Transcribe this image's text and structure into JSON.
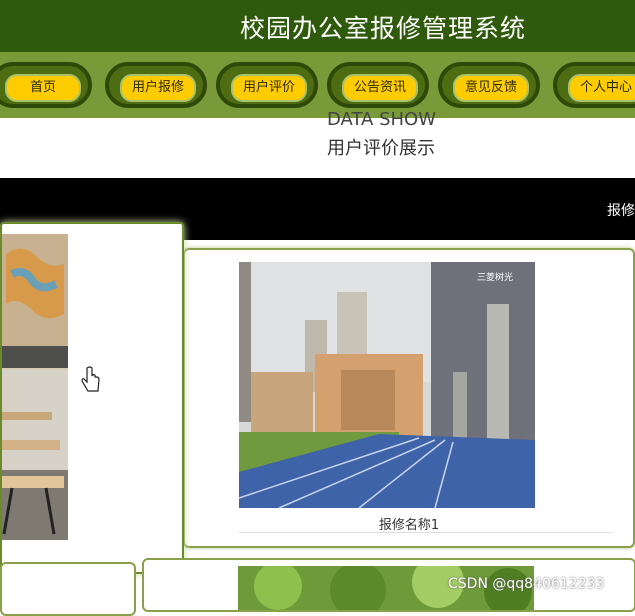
{
  "header": {
    "title": "校园办公室报修管理系统"
  },
  "nav": {
    "items": [
      {
        "label": "首页"
      },
      {
        "label": "用户报修"
      },
      {
        "label": "用户评价"
      },
      {
        "label": "公告资讯"
      },
      {
        "label": "意见反馈"
      },
      {
        "label": "个人中心"
      }
    ]
  },
  "section": {
    "subtitle": "DATA SHOW",
    "title": "用户评价展示",
    "band_text": "报修"
  },
  "cards": [
    {
      "caption": "报修名称1"
    }
  ],
  "watermark": "CSDN @qq840612233",
  "colors": {
    "header_bg": "#2f5a0c",
    "nav_bg": "#7a9a3a",
    "pill": "#ffcc00",
    "border": "#8aa04a"
  }
}
